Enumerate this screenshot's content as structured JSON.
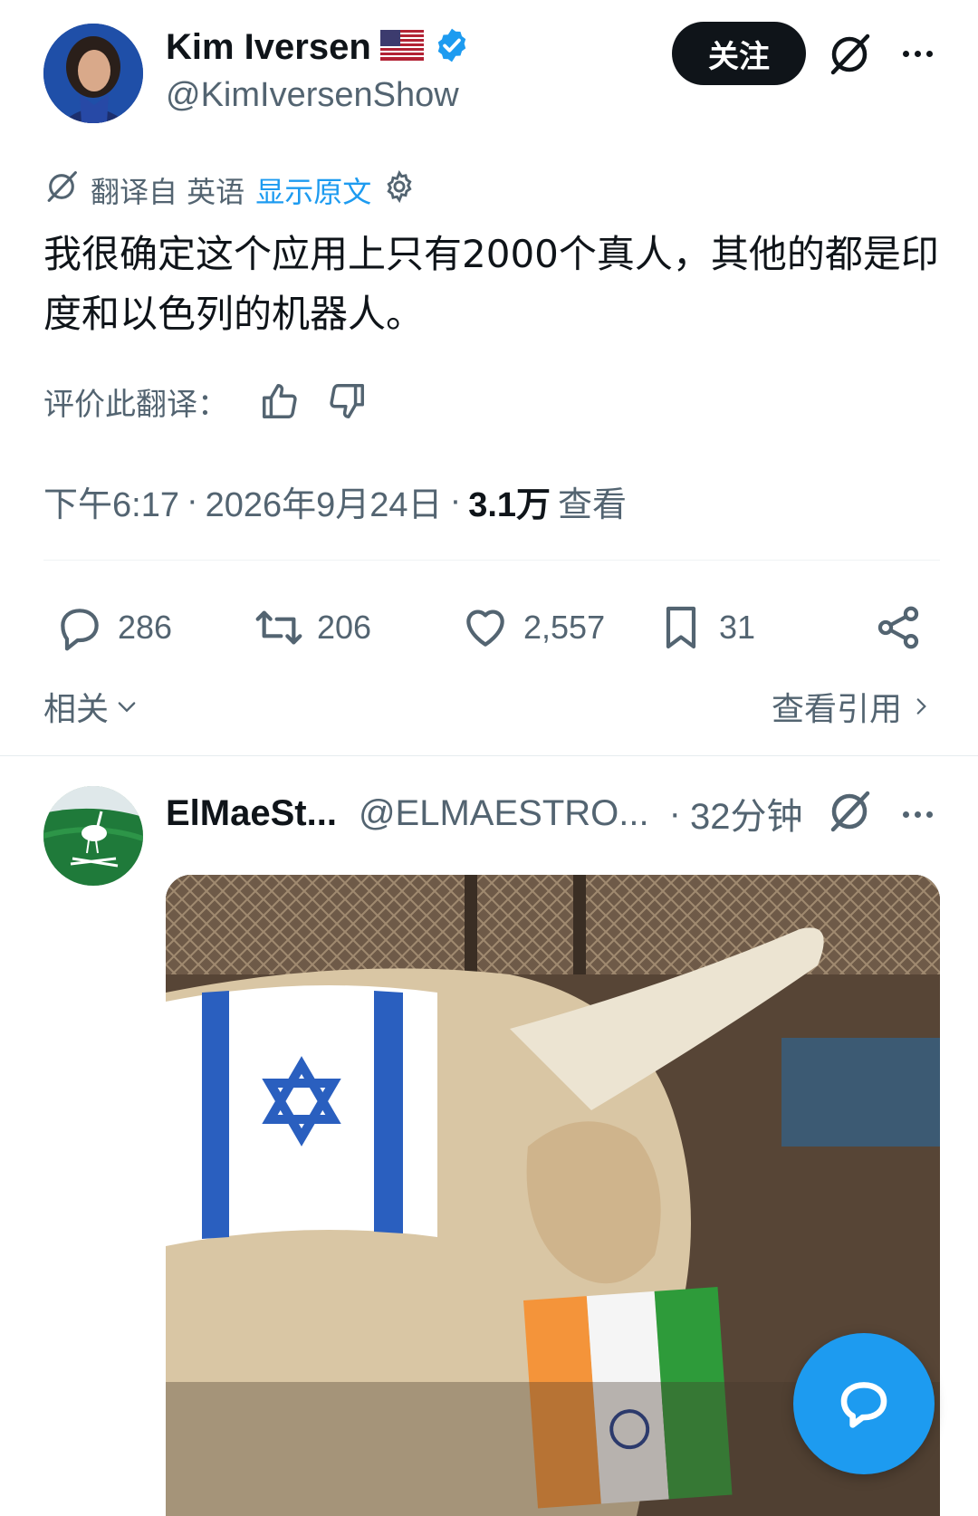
{
  "colors": {
    "text": "#0f1419",
    "muted": "#536471",
    "link": "#1d9bf0",
    "verified": "#1d9bf0",
    "follow_bg": "#0f1419"
  },
  "author": {
    "name": "Kim Iversen",
    "flag_icon": "us-flag-icon",
    "verified_icon": "verified-badge-icon",
    "handle": "@KimIversenShow"
  },
  "follow_label": "关注",
  "translation": {
    "label": "翻译自 英语",
    "show_original": "显示原文"
  },
  "tweet_text": "我很确定这个应用上只有2000个真人，其他的都是印度和以色列的机器人。",
  "rate_label": "评价此翻译：",
  "meta": {
    "time": "下午6:17",
    "date": "2026年9月24日",
    "views_count": "3.1万",
    "views_label": "查看"
  },
  "actions": {
    "replies": "286",
    "reposts": "206",
    "likes": "2,557",
    "bookmarks": "31"
  },
  "related_label": "相关",
  "view_quotes_label": "查看引用",
  "reply": {
    "name": "ElMaeSt...",
    "handle": "@ELMAESTRO...",
    "time": "32分钟"
  }
}
